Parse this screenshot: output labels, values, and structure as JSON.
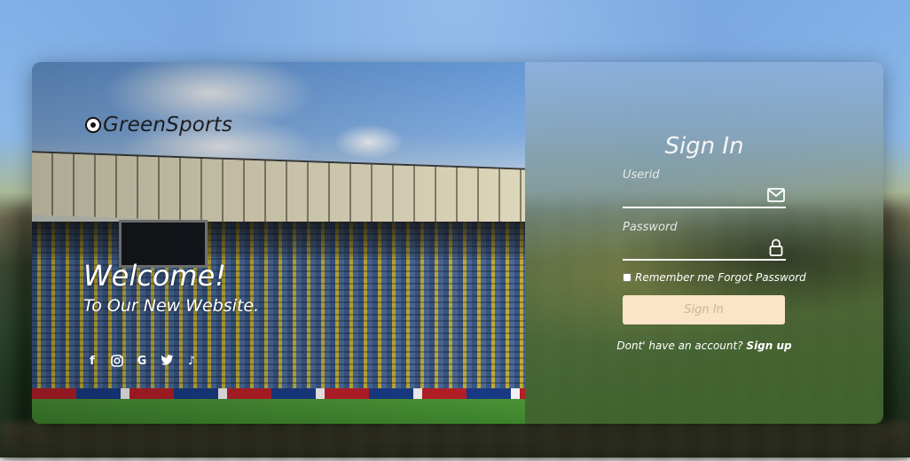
{
  "brand": {
    "name": "GreenSports"
  },
  "hero": {
    "welcome": "Welcome!",
    "tagline": "To Our New Website."
  },
  "socials": [
    {
      "name": "facebook",
      "glyph": "f"
    },
    {
      "name": "instagram",
      "glyph": "◎"
    },
    {
      "name": "google",
      "glyph": "G"
    },
    {
      "name": "twitter",
      "glyph": "🐦"
    },
    {
      "name": "tiktok",
      "glyph": "♪"
    }
  ],
  "signin": {
    "title": "Sign In",
    "userid_label": "Userid",
    "password_label": "Password",
    "remember_label": "Remember me",
    "forgot_label": "Forgot Password",
    "submit_label": "Sign In",
    "no_account_text": "Dont' have an account?",
    "signup_label": "Sign up"
  },
  "colors": {
    "button_bg": "#fbe4c7",
    "button_text": "#c9b79c"
  }
}
